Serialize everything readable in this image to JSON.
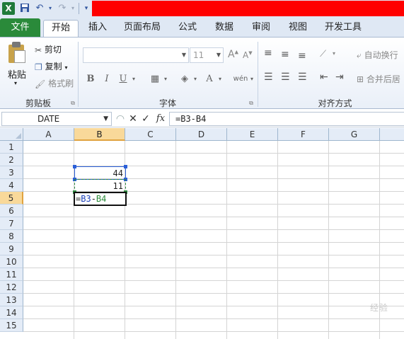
{
  "app": {
    "logo_letter": "X"
  },
  "qat": {
    "save_icon": "save-icon",
    "undo_icon": "undo-icon",
    "redo_icon": "redo-icon"
  },
  "tabs": [
    {
      "label": "文件"
    },
    {
      "label": "开始"
    },
    {
      "label": "插入"
    },
    {
      "label": "页面布局"
    },
    {
      "label": "公式"
    },
    {
      "label": "数据"
    },
    {
      "label": "审阅"
    },
    {
      "label": "视图"
    },
    {
      "label": "开发工具"
    }
  ],
  "ribbon": {
    "clipboard": {
      "paste_label": "粘贴",
      "cut_label": "剪切",
      "copy_label": "复制",
      "format_painter_label": "格式刷",
      "group_label": "剪贴板"
    },
    "font": {
      "font_name_value": "",
      "font_size_value": "11",
      "bold": "B",
      "italic": "I",
      "underline": "U",
      "grow": "A",
      "shrink": "A",
      "font_color": "A",
      "phonetic": "wén",
      "group_label": "字体"
    },
    "alignment": {
      "wrap_label": "自动换行",
      "merge_label": "合并后居",
      "group_label": "对齐方式"
    }
  },
  "formula_bar": {
    "name_box": "DATE",
    "cancel": "✕",
    "enter": "✓",
    "fx": "fx",
    "formula": "=B3-B4"
  },
  "grid": {
    "columns": [
      "A",
      "B",
      "C",
      "D",
      "E",
      "F",
      "G"
    ],
    "rows": [
      "1",
      "2",
      "3",
      "4",
      "5",
      "6",
      "7",
      "8",
      "9",
      "10",
      "11",
      "12",
      "13",
      "14",
      "15"
    ],
    "selected_column": "B",
    "selected_row": "5",
    "cells": {
      "B3": "44",
      "B4": "11",
      "B5_prefix": "=",
      "B5_ref1": "B3",
      "B5_op": "-",
      "B5_ref2": "B4"
    }
  },
  "watermark": "经验"
}
